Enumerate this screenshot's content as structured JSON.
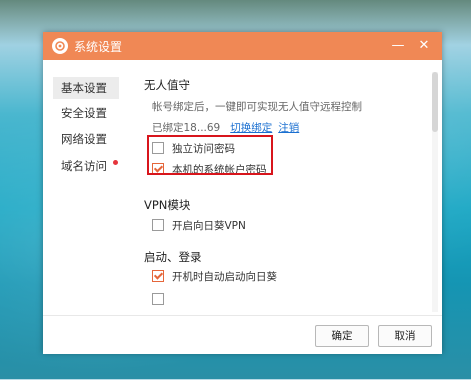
{
  "window": {
    "title": "系统设置",
    "minimize_glyph": "—",
    "close_glyph": "✕"
  },
  "sidebar": {
    "items": [
      {
        "label": "基本设置",
        "active": true
      },
      {
        "label": "安全设置",
        "active": false
      },
      {
        "label": "网络设置",
        "active": false
      },
      {
        "label": "域名访问",
        "active": false,
        "badge": "red-dot"
      }
    ]
  },
  "unattended": {
    "title": "无人值守",
    "description": "帐号绑定后，一键即可实现无人值守远程控制",
    "bound_text": "已绑定18...69",
    "switch_link": "切换绑定",
    "logout_link": "注销",
    "options": [
      {
        "label": "独立访问密码",
        "checked": false
      },
      {
        "label": "本机的系统帐户密码",
        "checked": true
      }
    ]
  },
  "vpn": {
    "title": "VPN模块",
    "options": [
      {
        "label": "开启向日葵VPN",
        "checked": false
      }
    ]
  },
  "startup": {
    "title": "启动、登录",
    "options": [
      {
        "label": "开机时自动启动向日葵",
        "checked": true
      }
    ]
  },
  "footer": {
    "ok_label": "确定",
    "cancel_label": "取消"
  },
  "colors": {
    "titlebar": "#f08855",
    "accent": "#e5663a",
    "highlight": "#d8151c",
    "link": "#1a6fd0"
  }
}
